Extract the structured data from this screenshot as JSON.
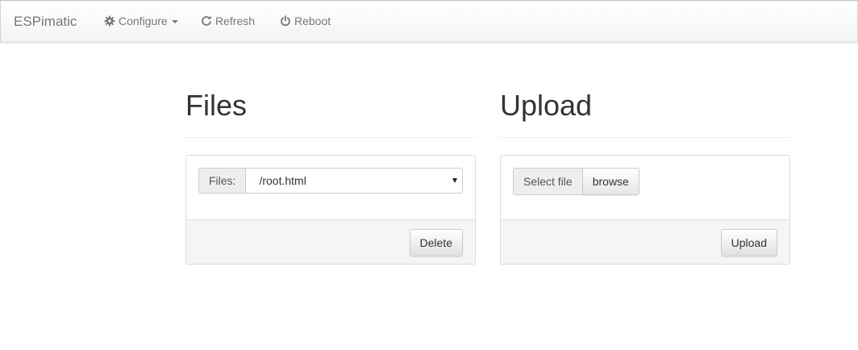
{
  "navbar": {
    "brand": "ESPimatic",
    "configure": {
      "label": "Configure",
      "icon": "gear-icon"
    },
    "refresh": {
      "label": "Refresh",
      "icon": "refresh-icon"
    },
    "reboot": {
      "label": "Reboot",
      "icon": "power-icon"
    }
  },
  "files": {
    "title": "Files",
    "addon_label": "Files:",
    "selected_file": "/root.html",
    "delete_label": "Delete"
  },
  "upload": {
    "title": "Upload",
    "select_file_label": "Select file",
    "browse_label": "browse",
    "upload_label": "Upload"
  },
  "colors": {
    "nav_text": "#777777",
    "heading_text": "#333333",
    "panel_footer_bg": "#f5f5f5",
    "border": "#dddddd"
  }
}
